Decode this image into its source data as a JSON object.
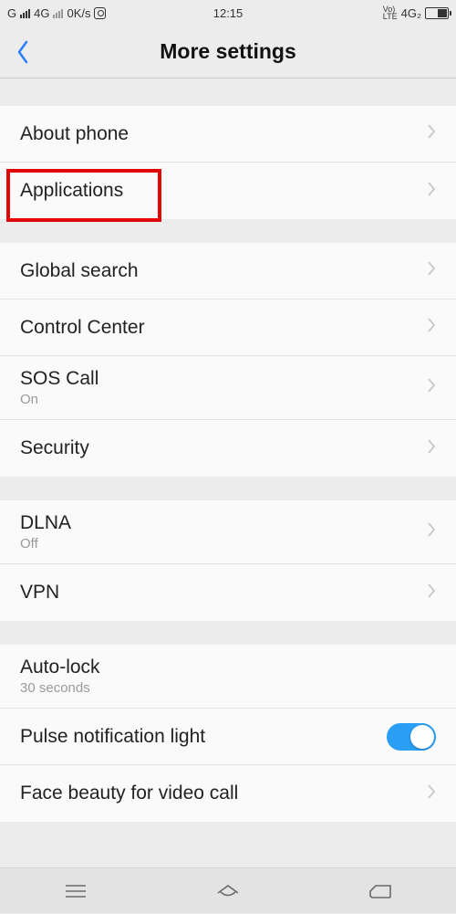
{
  "status": {
    "carrier": "G",
    "net1": "4G",
    "speed": "0K/s",
    "time": "12:15",
    "volte": "Vo)\nLTE",
    "net2": "4G₂"
  },
  "header": {
    "title": "More settings"
  },
  "groups": [
    {
      "items": [
        {
          "label": "About phone",
          "chevron": true
        },
        {
          "label": "Applications",
          "chevron": true,
          "highlight": true
        }
      ]
    },
    {
      "items": [
        {
          "label": "Global search",
          "chevron": true
        },
        {
          "label": "Control Center",
          "chevron": true
        },
        {
          "label": "SOS Call",
          "sub": "On",
          "chevron": true
        },
        {
          "label": "Security",
          "chevron": true
        }
      ]
    },
    {
      "items": [
        {
          "label": "DLNA",
          "sub": "Off",
          "chevron": true
        },
        {
          "label": "VPN",
          "chevron": true
        }
      ]
    },
    {
      "items": [
        {
          "label": "Auto-lock",
          "sub": "30 seconds",
          "chevron": false
        },
        {
          "label": "Pulse notification light",
          "toggle": true,
          "toggleOn": true
        },
        {
          "label": "Face beauty for video call",
          "chevron": true
        }
      ]
    }
  ]
}
